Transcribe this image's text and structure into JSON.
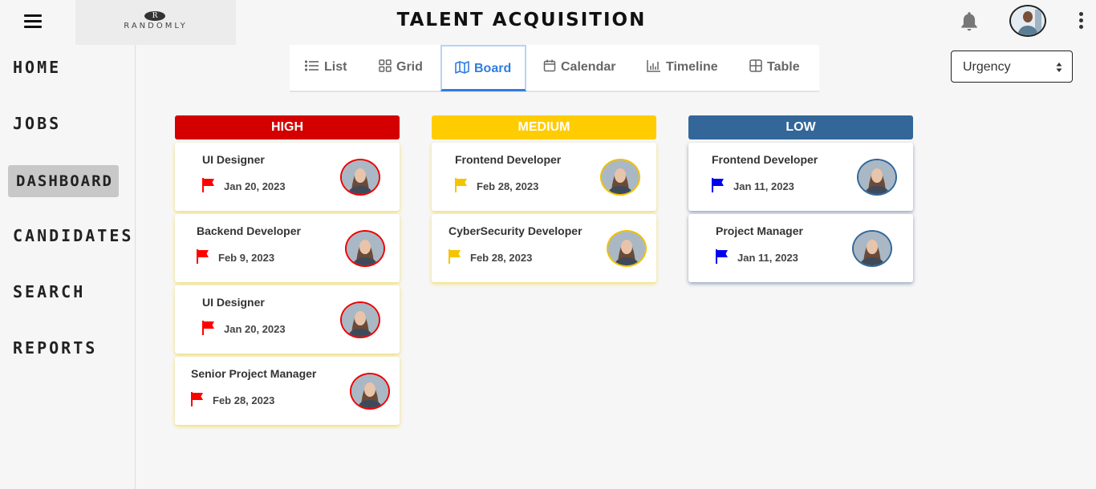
{
  "header": {
    "menu_icon": "hamburger-menu-icon",
    "logo_mark": "R",
    "logo_text": "RANDOMLY",
    "title": "TALENT ACQUISITION",
    "bell_icon": "bell-icon",
    "avatar_icon": "user-avatar",
    "more_icon": "vertical-dots-icon"
  },
  "sidebar": {
    "items": [
      {
        "label": "HOME"
      },
      {
        "label": "JOBS"
      },
      {
        "label": "DASHBOARD",
        "active": true
      },
      {
        "label": "CANDIDATES"
      },
      {
        "label": "SEARCH"
      },
      {
        "label": "REPORTS"
      }
    ]
  },
  "tabs": [
    {
      "label": "List",
      "icon": "list-icon"
    },
    {
      "label": "Grid",
      "icon": "grid-icon"
    },
    {
      "label": "Board",
      "icon": "map-icon",
      "active": true
    },
    {
      "label": "Calendar",
      "icon": "calendar-icon"
    },
    {
      "label": "Timeline",
      "icon": "bar-chart-icon"
    },
    {
      "label": "Table",
      "icon": "table-icon"
    }
  ],
  "sort_select": {
    "value": "Urgency"
  },
  "colors": {
    "high": "#d40000",
    "medium": "#ffcc00",
    "low": "#336699",
    "active_tab": "#2f7de1"
  },
  "board": {
    "columns": [
      {
        "label": "HIGH",
        "flag_color": "#ff0000",
        "cards": [
          {
            "title": "UI Designer",
            "date": "Jan 20, 2023"
          },
          {
            "title": "Backend Developer",
            "date": "Feb 9, 2023"
          },
          {
            "title": "UI Designer",
            "date": "Jan 20, 2023"
          },
          {
            "title": "Senior Project Manager",
            "date": "Feb 28, 2023"
          }
        ]
      },
      {
        "label": "MEDIUM",
        "flag_color": "#f5c400",
        "cards": [
          {
            "title": "Frontend Developer",
            "date": "Feb 28, 2023"
          },
          {
            "title": "CyberSecurity Developer",
            "date": "Feb 28, 2023"
          }
        ]
      },
      {
        "label": "LOW",
        "flag_color": "#0000ee",
        "cards": [
          {
            "title": "Frontend Developer",
            "date": "Jan 11, 2023"
          },
          {
            "title": "Project Manager",
            "date": "Jan 11, 2023"
          }
        ]
      }
    ]
  }
}
